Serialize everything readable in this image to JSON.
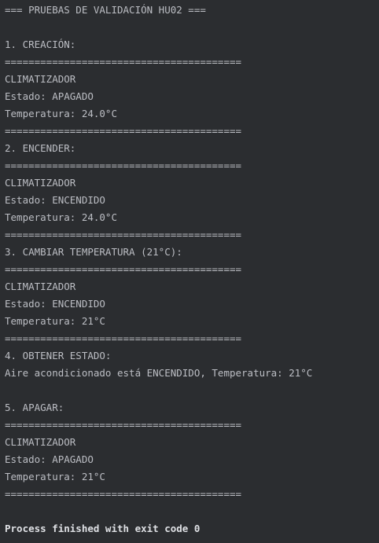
{
  "console": {
    "lines": [
      {
        "text": "=== PRUEBAS DE VALIDACIÓN HU02 ==="
      },
      {
        "text": ""
      },
      {
        "text": "1. CREACIÓN:"
      },
      {
        "text": "========================================"
      },
      {
        "text": "CLIMATIZADOR"
      },
      {
        "text": "Estado: APAGADO"
      },
      {
        "text": "Temperatura: 24.0°C"
      },
      {
        "text": "========================================"
      },
      {
        "text": "2. ENCENDER:"
      },
      {
        "text": "========================================"
      },
      {
        "text": "CLIMATIZADOR"
      },
      {
        "text": "Estado: ENCENDIDO"
      },
      {
        "text": "Temperatura: 24.0°C"
      },
      {
        "text": "========================================"
      },
      {
        "text": "3. CAMBIAR TEMPERATURA (21°C):"
      },
      {
        "text": "========================================"
      },
      {
        "text": "CLIMATIZADOR"
      },
      {
        "text": "Estado: ENCENDIDO"
      },
      {
        "text": "Temperatura: 21°C"
      },
      {
        "text": "========================================"
      },
      {
        "text": "4. OBTENER ESTADO:"
      },
      {
        "text": "Aire acondicionado está ENCENDIDO, Temperatura: 21°C"
      },
      {
        "text": ""
      },
      {
        "text": "5. APAGAR:"
      },
      {
        "text": "========================================"
      },
      {
        "text": "CLIMATIZADOR"
      },
      {
        "text": "Estado: APAGADO"
      },
      {
        "text": "Temperatura: 21°C"
      },
      {
        "text": "========================================"
      },
      {
        "text": ""
      },
      {
        "text": "Process finished with exit code 0",
        "bold": true
      }
    ]
  }
}
